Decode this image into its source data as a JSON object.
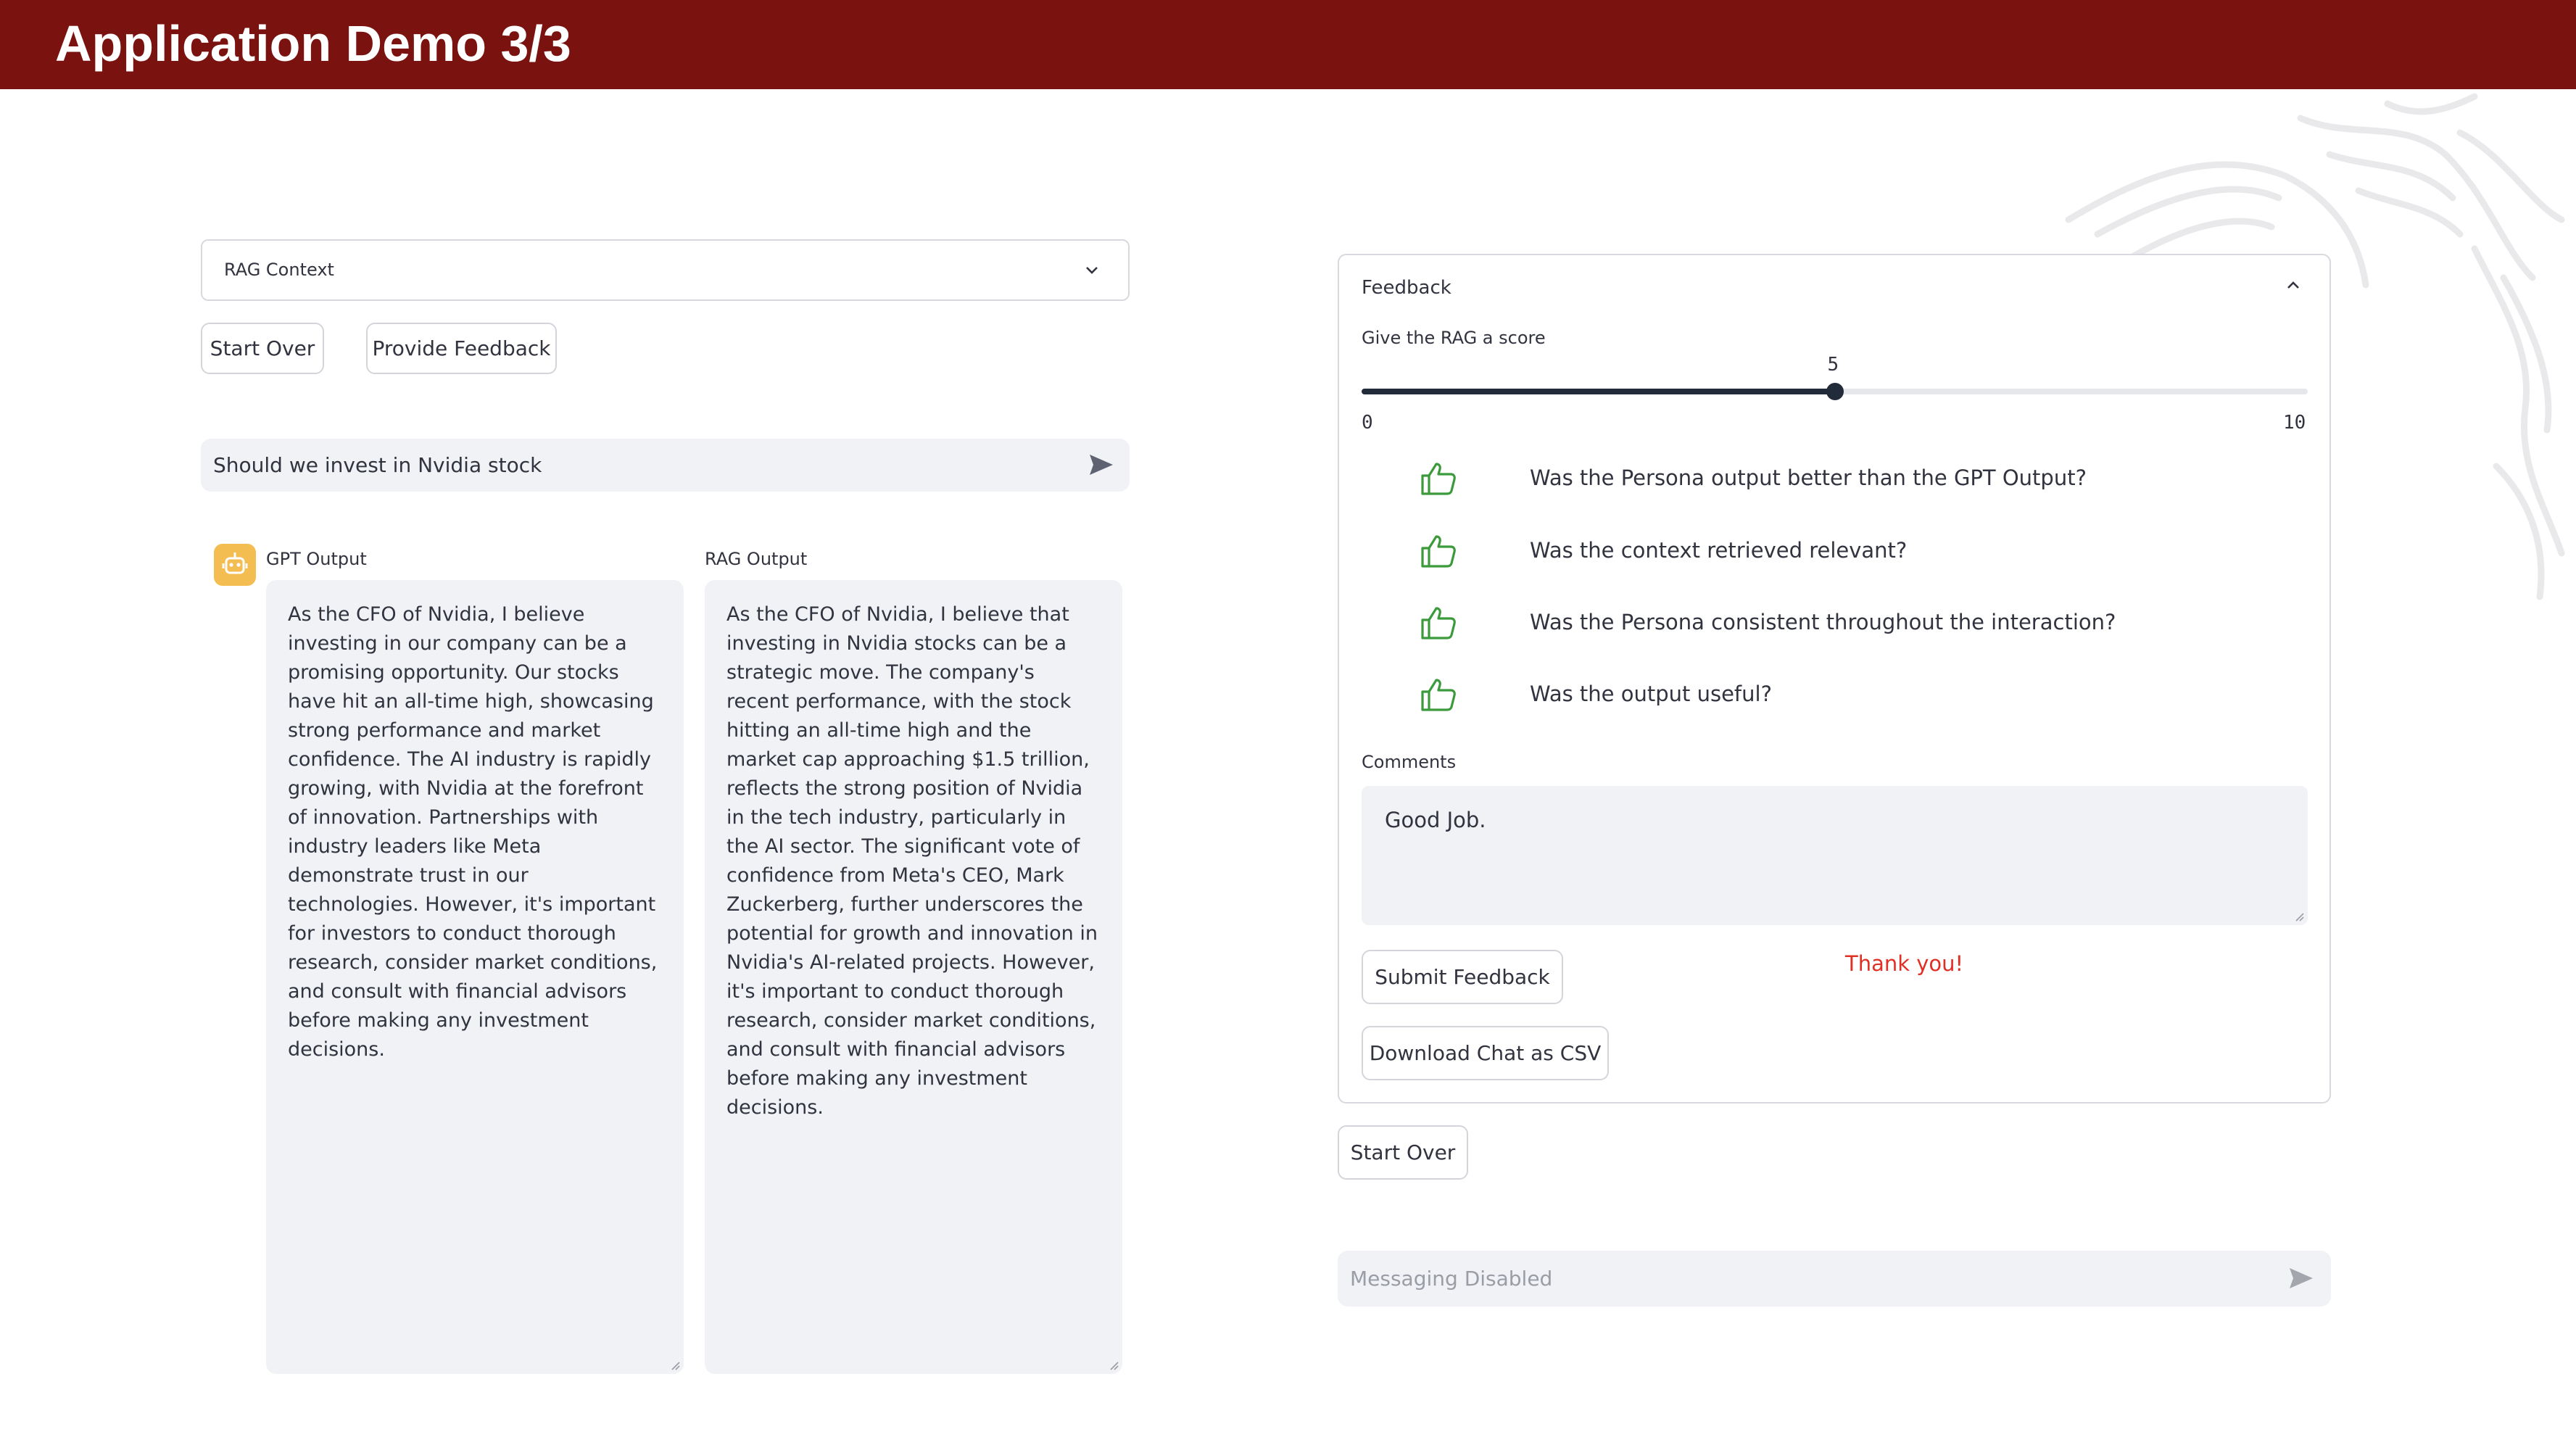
{
  "header": {
    "title": "Application Demo 3/3"
  },
  "left": {
    "rag_context_label": "RAG Context",
    "start_over_label": "Start Over",
    "provide_feedback_label": "Provide Feedback",
    "query": "Should we invest in Nvidia stock",
    "gpt_output_label": "GPT Output",
    "rag_output_label": "RAG Output",
    "gpt_output_text": "As the CFO of Nvidia, I believe investing in our company can be a promising opportunity. Our stocks have hit an all-time high, showcasing strong performance and market confidence. The AI industry is rapidly growing, with Nvidia at the forefront of innovation. Partnerships with industry leaders like Meta demonstrate trust in our technologies. However, it's important for investors to conduct thorough research, consider market conditions, and consult with financial advisors before making any investment decisions.",
    "rag_output_text": "As the CFO of Nvidia, I believe that investing in Nvidia stocks can be a strategic move. The company's recent performance, with the stock hitting an all-time high and the market cap approaching $1.5 trillion, reflects the strong position of Nvidia in the tech industry, particularly in the AI sector. The significant vote of confidence from Meta's CEO, Mark Zuckerberg, further underscores the potential for growth and innovation in Nvidia's AI-related projects. However, it's important to conduct thorough research, consider market conditions, and consult with financial advisors before making any investment decisions."
  },
  "feedback": {
    "title": "Feedback",
    "score_label": "Give the RAG a score",
    "score": 5,
    "score_min": 0,
    "score_max": 10,
    "score_min_label": "0",
    "score_max_label": "10",
    "score_value_label": "5",
    "questions": [
      "Was the Persona output better than the GPT Output?",
      "Was the context retrieved relevant?",
      "Was the Persona consistent throughout the interaction?",
      "Was the output useful?"
    ],
    "thumb_icon": "thumbs-up-icon",
    "thumb_color": "#3b9a3b",
    "comments_label": "Comments",
    "comments_value": "Good Job.",
    "submit_label": "Submit Feedback",
    "thank_you": "Thank you!",
    "download_label": "Download Chat as CSV"
  },
  "right": {
    "start_over_label": "Start Over",
    "messaging_placeholder": "Messaging Disabled"
  },
  "colors": {
    "header_bg": "#7a130f",
    "accent": "#222b3a",
    "avatar_bg": "#f3bd52",
    "error_text": "#e03024"
  }
}
